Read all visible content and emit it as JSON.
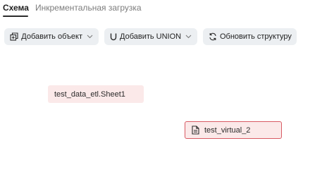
{
  "tabs": [
    {
      "label": "Схема",
      "active": true
    },
    {
      "label": "Инкрементальная загрузка",
      "active": false
    }
  ],
  "toolbar": {
    "add_object": {
      "label": "Добавить объект",
      "icon": "add-object-icon",
      "has_dropdown": true
    },
    "add_union": {
      "label": "Добавить UNION",
      "icon": "union-icon",
      "has_dropdown": true
    },
    "refresh": {
      "label": "Обновить структуру",
      "icon": "refresh-icon",
      "has_dropdown": false
    }
  },
  "canvas": {
    "nodes": [
      {
        "label": "test_data_etl.Sheet1",
        "icon": null,
        "selected": false
      },
      {
        "label": "test_virtual_2",
        "icon": "document-icon",
        "selected": true
      }
    ]
  },
  "colors": {
    "toolbar_button_bg": "#eceff2",
    "node_bg": "#fbe9e9",
    "node_selected_border": "#d85a63",
    "tab_active": "#1f1f1f",
    "tab_inactive": "#7c7c7c"
  }
}
